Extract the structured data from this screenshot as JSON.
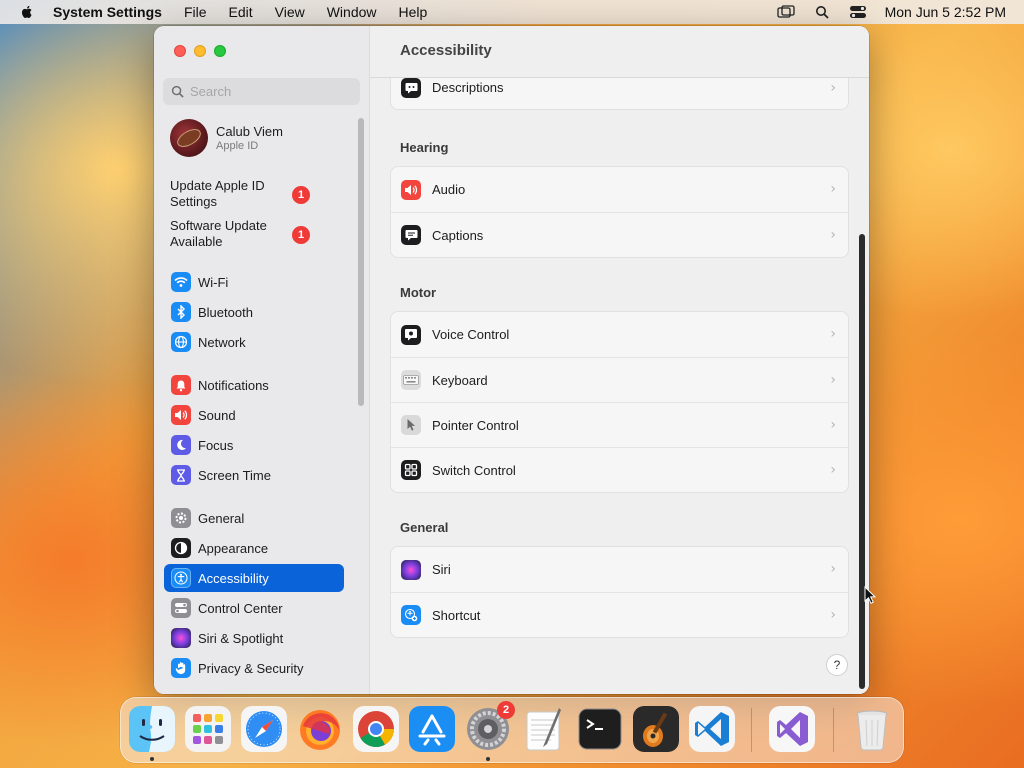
{
  "menubar": {
    "app_name": "System Settings",
    "menus": [
      "File",
      "Edit",
      "View",
      "Window",
      "Help"
    ],
    "clock": "Mon Jun 5  2:52 PM"
  },
  "sidebar": {
    "search_placeholder": "Search",
    "profile": {
      "name": "Calub Viem",
      "subtitle": "Apple ID"
    },
    "notices": [
      {
        "label": "Update Apple ID Settings",
        "badge": "1"
      },
      {
        "label": "Software Update Available",
        "badge": "1"
      }
    ],
    "items": [
      {
        "label": "Wi-Fi",
        "icon": "wifi-icon",
        "color": "#1a8cf5"
      },
      {
        "label": "Bluetooth",
        "icon": "bluetooth-icon",
        "color": "#1a8cf5"
      },
      {
        "label": "Network",
        "icon": "globe-icon",
        "color": "#1a8cf5"
      },
      {
        "label": "Notifications",
        "icon": "bell-icon",
        "color": "#f2453d"
      },
      {
        "label": "Sound",
        "icon": "speaker-icon",
        "color": "#f2453d"
      },
      {
        "label": "Focus",
        "icon": "moon-icon",
        "color": "#5e5ce6"
      },
      {
        "label": "Screen Time",
        "icon": "hourglass-icon",
        "color": "#5e5ce6"
      },
      {
        "label": "General",
        "icon": "gear-icon",
        "color": "#8e8e93"
      },
      {
        "label": "Appearance",
        "icon": "appearance-icon",
        "color": "#1d1d1f"
      },
      {
        "label": "Accessibility",
        "icon": "accessibility-icon",
        "color": "#1a8cf5"
      },
      {
        "label": "Control Center",
        "icon": "control-center-icon",
        "color": "#8e8e93"
      },
      {
        "label": "Siri & Spotlight",
        "icon": "siri-icon",
        "color": "#7a3fe0"
      },
      {
        "label": "Privacy & Security",
        "icon": "hand-icon",
        "color": "#1a8cf5"
      }
    ],
    "active": "Accessibility"
  },
  "content": {
    "title": "Accessibility",
    "top_row": {
      "label": "Descriptions",
      "icon": "descriptions-icon"
    },
    "sections": [
      {
        "title": "Hearing",
        "rows": [
          {
            "label": "Audio",
            "icon": "speaker-icon"
          },
          {
            "label": "Captions",
            "icon": "captions-icon"
          }
        ]
      },
      {
        "title": "Motor",
        "rows": [
          {
            "label": "Voice Control",
            "icon": "voice-control-icon"
          },
          {
            "label": "Keyboard",
            "icon": "keyboard-icon"
          },
          {
            "label": "Pointer Control",
            "icon": "pointer-icon"
          },
          {
            "label": "Switch Control",
            "icon": "switch-control-icon"
          }
        ]
      },
      {
        "title": "General",
        "rows": [
          {
            "label": "Siri",
            "icon": "siri-icon"
          },
          {
            "label": "Shortcut",
            "icon": "shortcut-icon"
          }
        ]
      }
    ],
    "help": "?"
  },
  "dock": {
    "apps": [
      "Finder",
      "Launchpad",
      "Safari",
      "Firefox",
      "Chrome",
      "App Store",
      "System Settings",
      "TextEdit",
      "Terminal",
      "GarageBand",
      "Visual Studio Code",
      "Visual Studio",
      "Trash"
    ],
    "settings_badge": "2"
  }
}
